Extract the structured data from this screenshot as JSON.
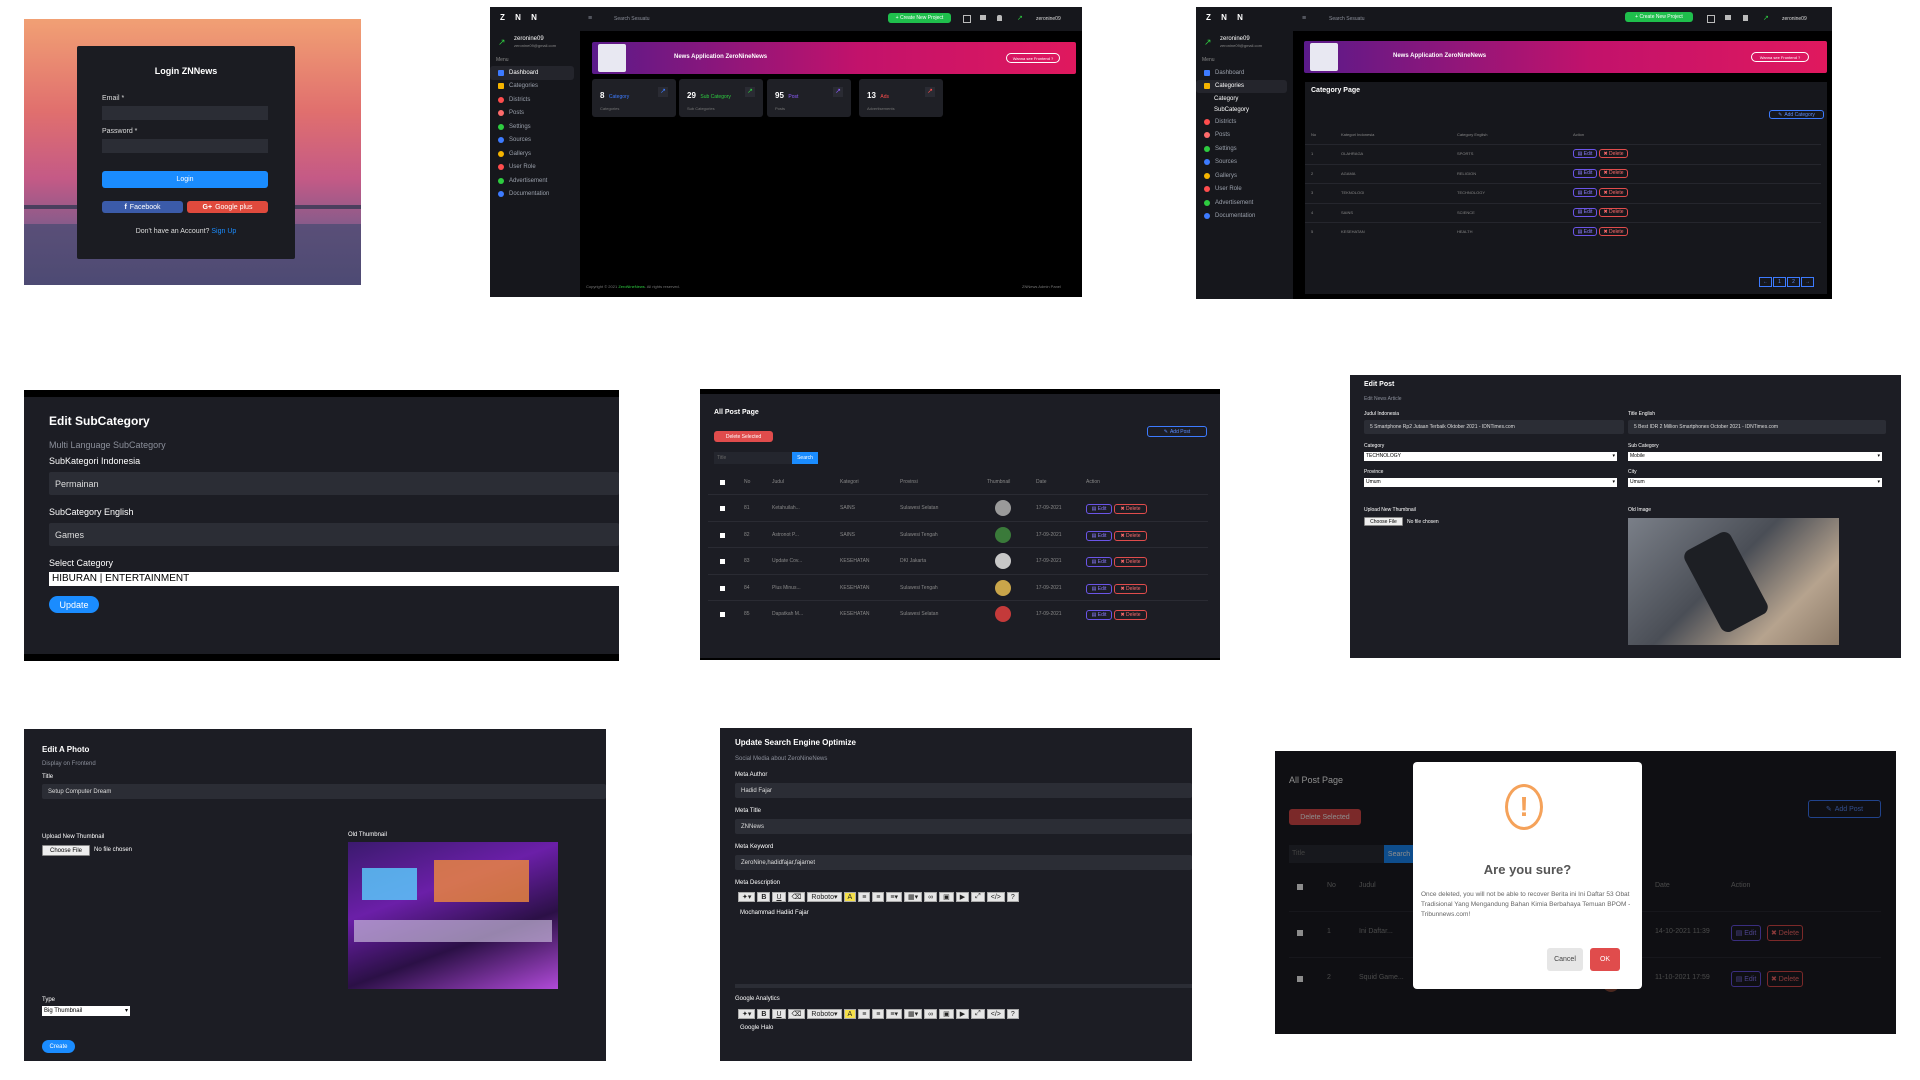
{
  "login": {
    "title": "Login ZNNews",
    "email_label": "Email *",
    "password_label": "Password *",
    "login_button": "Login",
    "facebook_button": "Facebook",
    "google_button": "Google plus",
    "signup_text": "Don't have an Account?",
    "signup_link": "Sign Up"
  },
  "admin": {
    "logo": "Z N N",
    "search_placeholder": "Search Sesuatu",
    "create_button": "+ Create New Project",
    "user_name": "zeronine09",
    "user_email": "zeronine09@gmail.com",
    "menu_label": "Menu",
    "menu_items": [
      "Dashboard",
      "Categories",
      "Districts",
      "Posts",
      "Settings",
      "Sources",
      "Gallerys",
      "User Role",
      "Advertisement",
      "Documentation"
    ],
    "category_sub_items": [
      "Category",
      "SubCategory"
    ],
    "banner_title": "News Application ZeroNineNews",
    "banner_button": "Wanna see Frontend ?",
    "stats": [
      {
        "value": "8",
        "label": "Category",
        "sub": "Categories",
        "color": "#3d7bff"
      },
      {
        "value": "29",
        "label": "Sub Category",
        "sub": "Sub Categories",
        "color": "#2ecc40"
      },
      {
        "value": "95",
        "label": "Post",
        "sub": "Posts",
        "color": "#8e5cff"
      },
      {
        "value": "13",
        "label": "Ads",
        "sub": "Advertisements",
        "color": "#ff4d4d"
      }
    ],
    "footer_left_prefix": "Copyright © 2021 ",
    "footer_brand": "ZeroNineNews",
    "footer_left_suffix": ". All rights reserved.",
    "footer_right": "ZNNews Admin Panel"
  },
  "category_page": {
    "title": "Category Page",
    "add_button": "Add Category",
    "columns": [
      "No",
      "Kategori Indonesia",
      "Category English",
      "Action"
    ],
    "rows": [
      {
        "no": "1",
        "id": "OLAHRAGA",
        "en": "SPORTS"
      },
      {
        "no": "2",
        "id": "AGAMA",
        "en": "RELIGION"
      },
      {
        "no": "3",
        "id": "TEKNOLOGI",
        "en": "TECHNOLOGY"
      },
      {
        "no": "4",
        "id": "SAINS",
        "en": "SCIENCE"
      },
      {
        "no": "5",
        "id": "KESEHATAN",
        "en": "HEALTH"
      }
    ],
    "edit_label": "Edit",
    "delete_label": "Delete",
    "pagination": [
      "←",
      "1",
      "2",
      "→"
    ]
  },
  "edit_subcategory": {
    "title": "Edit SubCategory",
    "subtitle": "Multi Language SubCategory",
    "id_label": "SubKategori Indonesia",
    "id_value": "Permainan",
    "en_label": "SubCategory English",
    "en_value": "Games",
    "select_label": "Select Category",
    "select_value": "HIBURAN | ENTERTAINMENT",
    "update_button": "Update"
  },
  "all_post": {
    "title": "All Post Page",
    "delete_selected": "Delete Selected",
    "add_post": "Add Post",
    "search_placeholder": "Title",
    "search_button": "Search",
    "columns": [
      "No",
      "Judul",
      "Kategori",
      "Provinsi",
      "Thumbnail",
      "Date",
      "Action"
    ],
    "rows": [
      {
        "no": "81",
        "judul": "Ketahuilah...",
        "kategori": "SAINS",
        "provinsi": "Sulawesi Selatan",
        "date": "17-09-2021",
        "thumb": "#9a9a9a"
      },
      {
        "no": "82",
        "judul": "Astronot P...",
        "kategori": "SAINS",
        "provinsi": "Sulawesi Tengah",
        "date": "17-09-2021",
        "thumb": "#3a7a3a"
      },
      {
        "no": "83",
        "judul": "Update Cov...",
        "kategori": "KESEHATAN",
        "provinsi": "DKI Jakarta",
        "date": "17-09-2021",
        "thumb": "#c8c8c8"
      },
      {
        "no": "84",
        "judul": "Plus Minus...",
        "kategori": "KESEHATAN",
        "provinsi": "Sulawesi Tengah",
        "date": "17-09-2021",
        "thumb": "#c9a54a"
      },
      {
        "no": "85",
        "judul": "Dapatkah M...",
        "kategori": "KESEHATAN",
        "provinsi": "Sulawesi Selatan",
        "date": "17-09-2021",
        "thumb": "#c43a3a"
      }
    ],
    "edit_label": "Edit",
    "delete_label": "Delete"
  },
  "edit_post": {
    "title": "Edit Post",
    "subtitle": "Edit News Article",
    "judul_label": "Judul Indonesia",
    "judul_value": "5 Smartphone Rp2 Jutaan Terbaik Oktober 2021 - IDNTimes.com",
    "title_en_label": "Title English",
    "title_en_value": "5 Best IDR 2 Million Smartphones October 2021 - IDNTimes.com",
    "category_label": "Category",
    "category_value": "TECHNOLOGY",
    "subcategory_label": "Sub Category",
    "subcategory_value": "Mobile",
    "province_label": "Province",
    "province_value": "Umum",
    "city_label": "City",
    "city_value": "Umum",
    "upload_label": "Upload New Thumbnail",
    "choose_file": "Choose File",
    "no_file": "No file chosen",
    "old_image_label": "Old Image"
  },
  "edit_photo": {
    "title": "Edit A Photo",
    "subtitle": "Display on Frontend",
    "title_label": "Title",
    "title_value": "Setup Computer Dream",
    "upload_label": "Upload New Thumbnail",
    "choose_file": "Choose File",
    "no_file": "No file chosen",
    "old_thumb_label": "Old Thumbnail",
    "type_label": "Type",
    "type_value": "Big Thumbnail",
    "create_button": "Create"
  },
  "seo": {
    "title": "Update Search Engine Optimize",
    "subtitle": "Social Media about ZeroNineNews",
    "author_label": "Meta Author",
    "author_value": "Hadid Fajar",
    "meta_title_label": "Meta Title",
    "meta_title_value": "ZNNews",
    "keyword_label": "Meta Keyword",
    "keyword_value": "ZeroNine,hadidfajar,fajarnet",
    "desc_label": "Meta Description",
    "desc_value": "Mochammad Hadiid Fajar",
    "analytics_label": "Google Analytics",
    "analytics_value": "Google Halo",
    "font_select": "Roboto"
  },
  "confirm_dialog": {
    "page_title": "All Post Page",
    "delete_selected": "Delete Selected",
    "add_post": "Add Post",
    "search_placeholder": "Title",
    "search_button": "Search",
    "columns": [
      "No",
      "Judul",
      "Date",
      "Action"
    ],
    "rows": [
      {
        "no": "1",
        "judul": "Ini Daftar...",
        "kategori": "",
        "provinsi": "",
        "date": "14-10-2021 11:39"
      },
      {
        "no": "2",
        "judul": "Squid Game...",
        "kategori": "HIBURAN",
        "provinsi": "Umum",
        "date": "11-10-2021 17:59"
      }
    ],
    "edit_label": "Edit",
    "delete_label": "Delete",
    "icon": "!",
    "heading": "Are you sure?",
    "message": "Once deleted, you will not be able to recover Berita ini Ini Daftar 53 Obat Tradisional Yang Mengandung Bahan Kimia Berbahaya Temuan BPOM - Tribunnews.com!",
    "cancel_button": "Cancel",
    "ok_button": "OK"
  }
}
